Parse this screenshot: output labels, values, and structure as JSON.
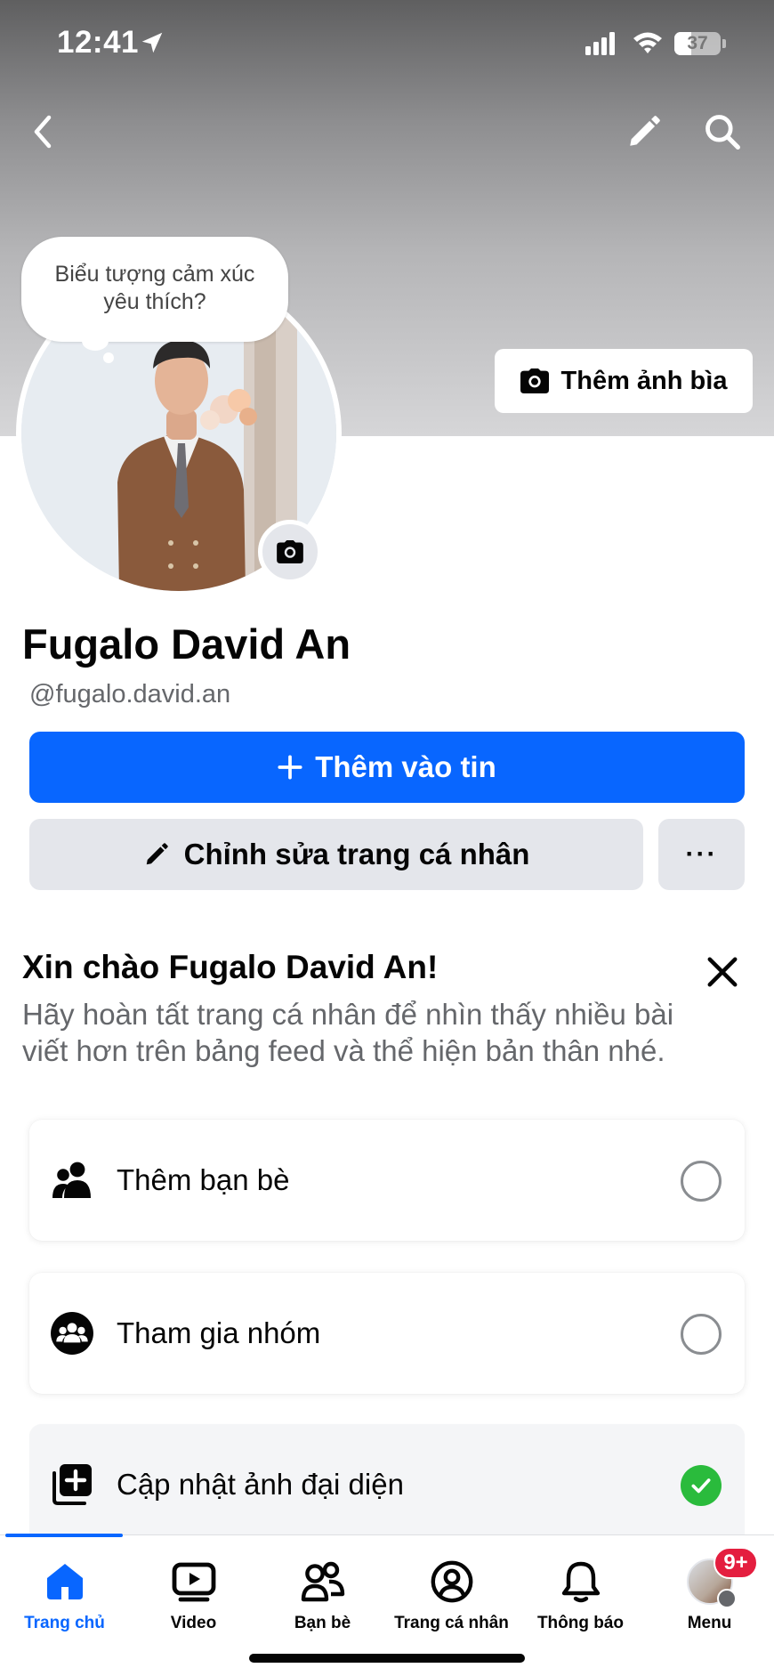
{
  "status_bar": {
    "time": "12:41",
    "battery_level": "37",
    "battery_fraction": 0.37
  },
  "header": {
    "back_icon": "chevron-left-icon",
    "edit_icon": "pencil-icon",
    "search_icon": "search-icon"
  },
  "cover": {
    "add_cover_label": "Thêm ảnh bìa",
    "camera_icon": "camera-icon"
  },
  "avatar": {
    "bubble_text_line1": "Biểu tượng cảm xúc",
    "bubble_text_line2": "yêu thích?",
    "camera_icon": "camera-icon"
  },
  "profile": {
    "name": "Fugalo David An",
    "handle": "@fugalo.david.an"
  },
  "actions": {
    "add_story_label": "Thêm vào tin",
    "edit_profile_label": "Chỉnh sửa trang cá nhân",
    "more_label": "···",
    "primary_color": "#0866ff"
  },
  "onboarding": {
    "title": "Xin chào Fugalo David An!",
    "description": "Hãy hoàn tất trang cá nhân để nhìn thấy nhiều bài viết hơn trên bảng feed và thể hiện bản thân nhé.",
    "tasks": [
      {
        "label": "Thêm bạn bè",
        "icon": "friends-icon",
        "done": false
      },
      {
        "label": "Tham gia nhóm",
        "icon": "groups-icon",
        "done": false
      },
      {
        "label": "Cập nhật ảnh đại diện",
        "icon": "add-photo-icon",
        "done": true
      }
    ],
    "check_color": "#2abb3c"
  },
  "tabbar": {
    "tabs": [
      {
        "label": "Trang chủ",
        "icon": "home-icon",
        "active": true
      },
      {
        "label": "Video",
        "icon": "video-icon",
        "active": false
      },
      {
        "label": "Bạn bè",
        "icon": "friends-icon",
        "active": false
      },
      {
        "label": "Trang cá nhân",
        "icon": "profile-icon",
        "active": false
      },
      {
        "label": "Thông báo",
        "icon": "bell-icon",
        "active": false
      },
      {
        "label": "Menu",
        "icon": "avatar-icon",
        "active": false
      }
    ],
    "menu_badge": "9+"
  }
}
